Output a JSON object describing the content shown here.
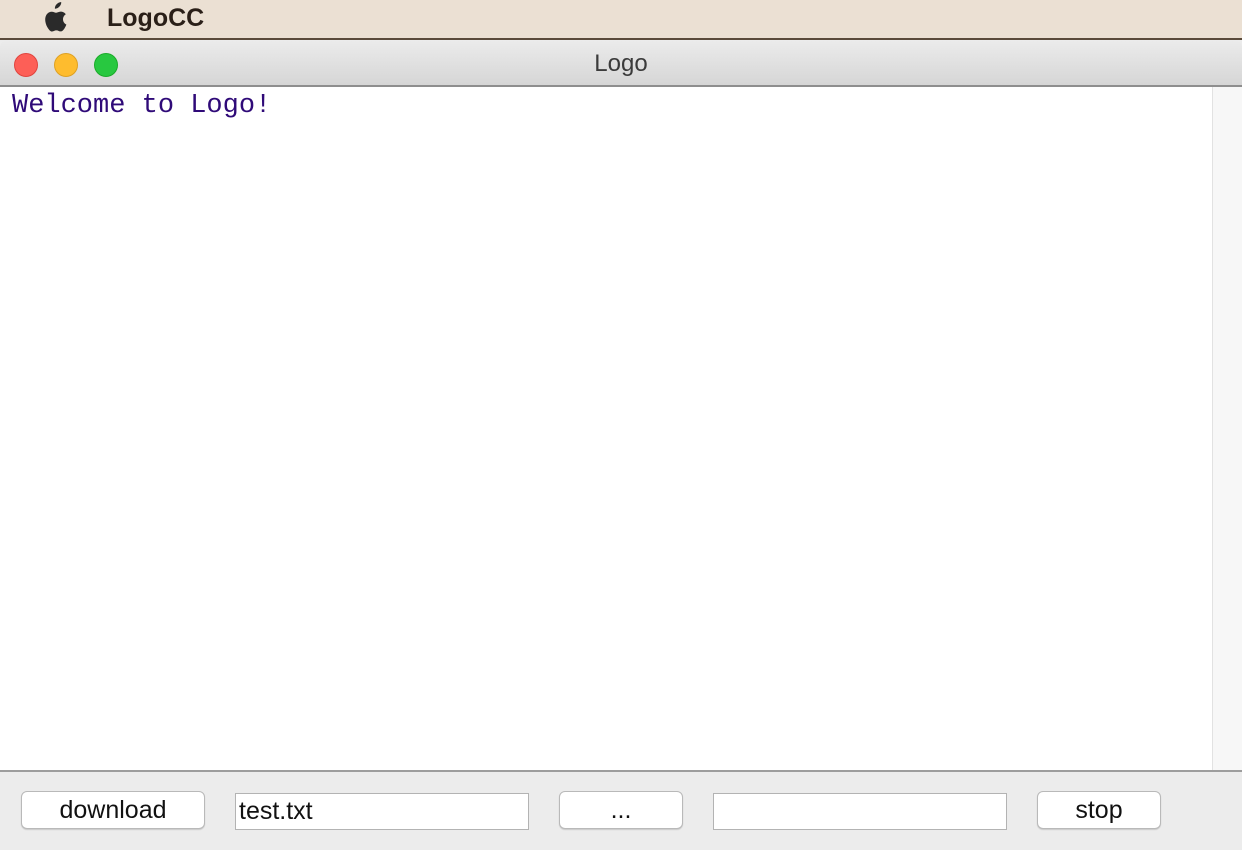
{
  "menubar": {
    "apple_icon": "apple-logo-icon",
    "app_name": "LogoCC"
  },
  "window": {
    "title": "Logo",
    "controls": [
      "close",
      "minimize",
      "zoom"
    ]
  },
  "console": {
    "text": "Welcome to Logo!",
    "text_color": "#2f0a78"
  },
  "toolbar": {
    "download_label": "download",
    "file_value": "test.txt",
    "browse_label": "...",
    "command_value": "",
    "stop_label": "stop"
  }
}
